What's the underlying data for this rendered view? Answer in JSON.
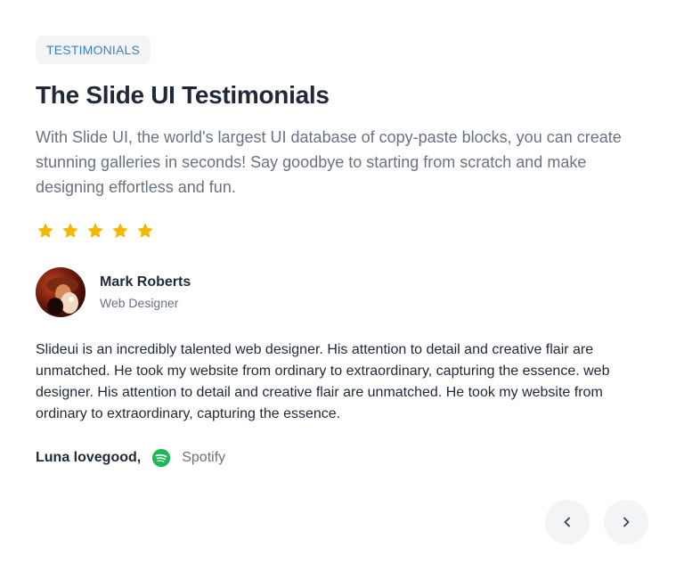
{
  "badge": "TESTIMONIALS",
  "title": "The Slide UI Testimonials",
  "lead": "With Slide UI, the world's largest UI database of copy-paste blocks, you can create stunning galleries in seconds! Say goodbye to starting from scratch and make designing effortless and fun.",
  "rating": {
    "value": 5,
    "max": 5,
    "color": "#f5b800"
  },
  "author": {
    "name": "Mark Roberts",
    "role": "Web Designer"
  },
  "quote": "Slideui is an incredibly talented web designer. His attention to detail and creative flair are unmatched. He took my website from ordinary to extraordinary, capturing the essence. web designer. His attention to detail and creative flair are unmatched. He took my website from ordinary to extraordinary, capturing the essence.",
  "source": {
    "name": "Luna lovegood,",
    "brand": "Spotify",
    "brand_icon": "spotify-icon",
    "brand_color": "#1db954"
  },
  "nav": {
    "prev_icon": "chevron-left-icon",
    "next_icon": "chevron-right-icon"
  }
}
